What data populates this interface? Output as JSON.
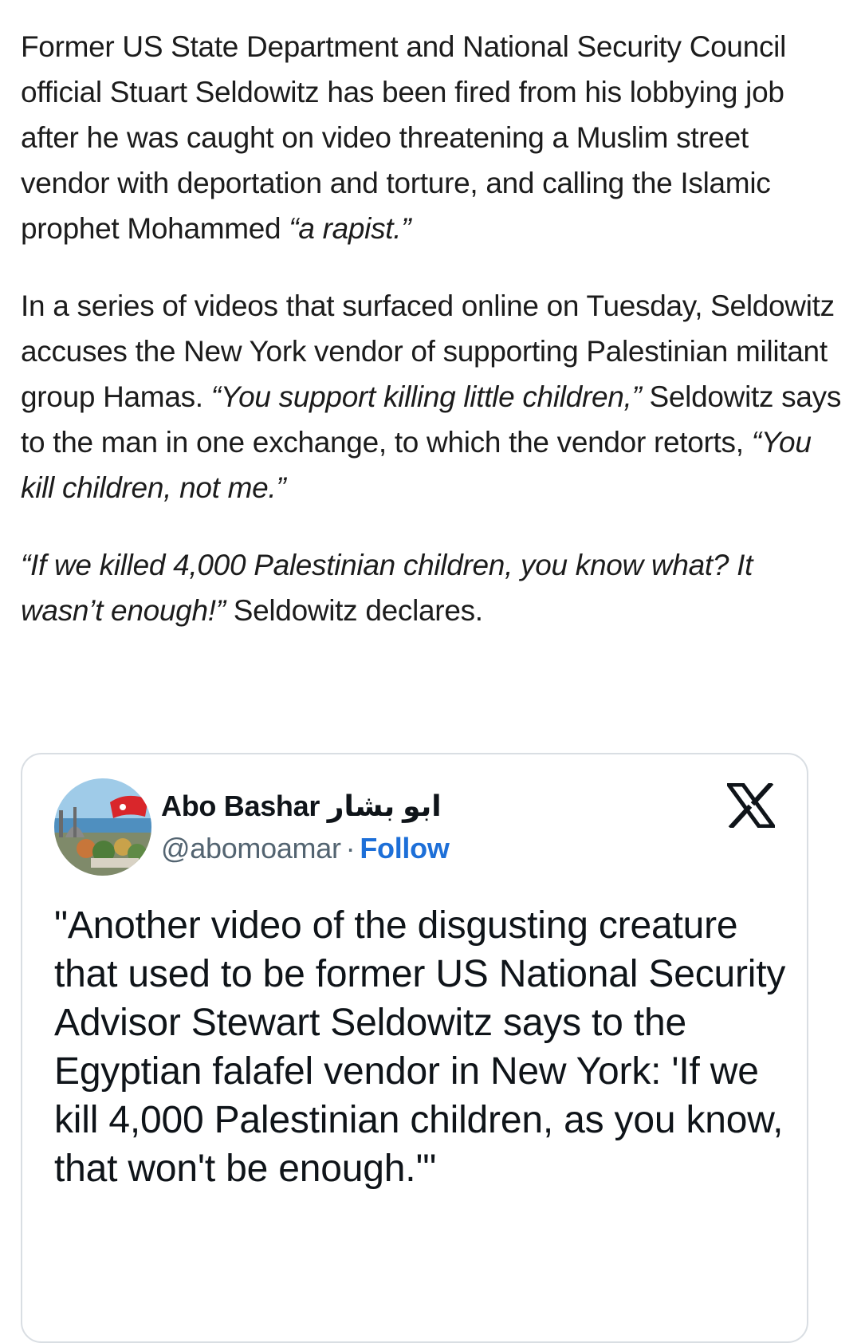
{
  "article": {
    "para1_text": "Former US State Department and National Security Council official Stuart Seldowitz has been fired from his lobbying job after he was caught on video threatening a Muslim street vendor with deportation and torture, and calling the Islamic prophet Mohammed ",
    "para1_quote": "“a rapist.”",
    "para2_text": "In a series of videos that surfaced online on Tuesday, Seldowitz accuses the New York vendor of supporting Palestinian militant group Hamas. ",
    "para2_quote1": "“You support killing little children,”",
    "para2_mid": " Seldowitz says to the man in one exchange, to which the vendor retorts, ",
    "para2_quote2": "“You kill children, not me.”",
    "para3_quote": "“If we killed 4,000 Palestinian children, you know what? It wasn’t enough!”",
    "para3_text": " Seldowitz declares."
  },
  "tweet": {
    "author_name": "Abo Bashar ابو بشار",
    "handle": "@abomoamar",
    "separator": "·",
    "follow_label": "Follow",
    "logo_icon": "x-logo-icon",
    "text": "\"Another video of the disgusting creature that used to be former US National Security Advisor Stewart Seldowitz says to the Egyptian falafel vendor in New York: 'If we kill 4,000 Palestinian children, as you know, that won't be enough.'\""
  },
  "colors": {
    "body_text": "#1c1c1c",
    "tweet_text": "#0f1419",
    "handle": "#536471",
    "follow_link": "#1d6fd8",
    "card_border": "#d9dee3"
  }
}
